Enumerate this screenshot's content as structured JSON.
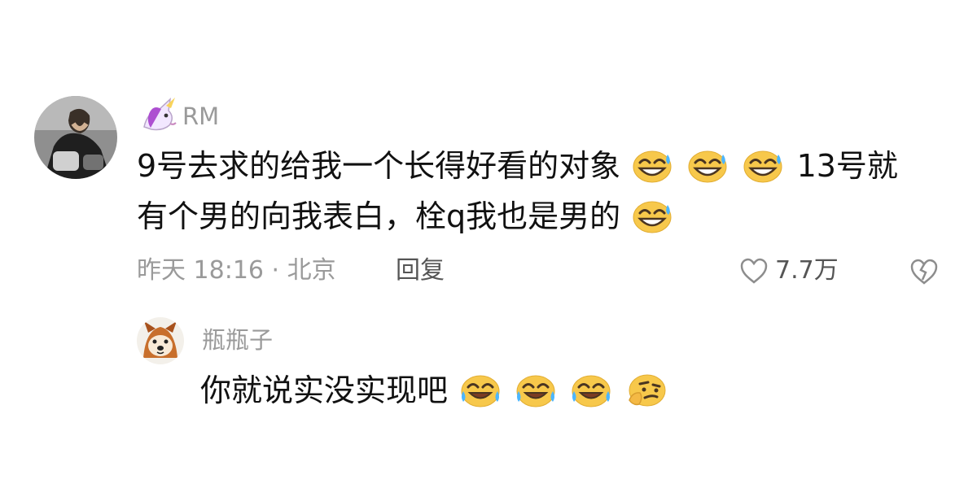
{
  "comment": {
    "username": "RM",
    "username_icon": "unicorn-emoji",
    "line1_text": "9号去求的给我一个长得好看的对象",
    "line1_suffix": "13号就",
    "line2_text": "有个男的向我表白，栓q我也是男的",
    "emojis_line1": [
      "grin-sweat-emoji",
      "grin-sweat-emoji",
      "grin-sweat-emoji"
    ],
    "emojis_line2": [
      "grin-sweat-emoji"
    ],
    "meta": {
      "time_location": "昨天 18:16 · 北京",
      "reply_label": "回复"
    },
    "likes": "7.7万"
  },
  "reply": {
    "username": "瓶瓶子",
    "text": "你就说实没实现吧",
    "emojis": [
      "laugh-cry-emoji",
      "laugh-cry-emoji",
      "laugh-cry-emoji",
      "thinking-emoji"
    ]
  },
  "colors": {
    "meta_gray": "#9a9a9a",
    "dark_gray": "#555555",
    "emoji_yellow": "#f7c84b"
  }
}
